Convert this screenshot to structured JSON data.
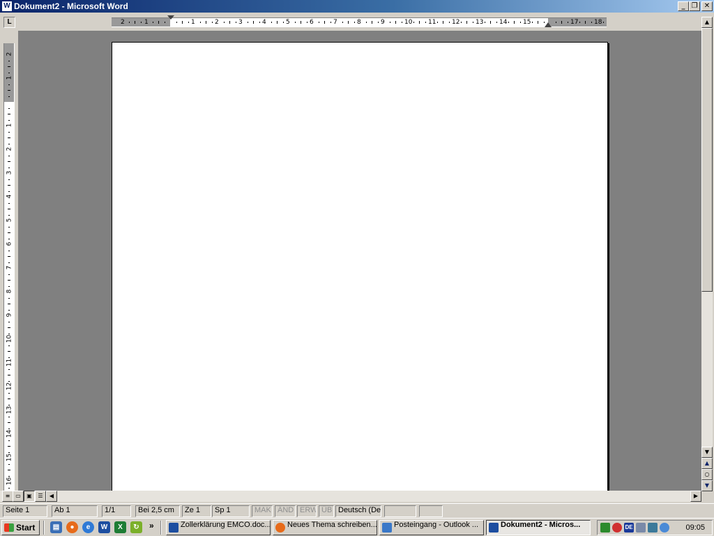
{
  "window": {
    "title": "Dokument2 - Microsoft Word",
    "app_icon": "W",
    "controls": {
      "minimize": "_",
      "restore": "❐",
      "close": "✕"
    }
  },
  "ruler": {
    "tab_selector": "L",
    "h_left_labels": [
      "2",
      "1"
    ],
    "h_labels": [
      "1",
      "2",
      "3",
      "4",
      "5",
      "6",
      "7",
      "8",
      "9",
      "10",
      "11",
      "12",
      "13",
      "14",
      "15",
      "",
      "17",
      "18"
    ],
    "v_top_labels": [
      "2",
      "1"
    ],
    "v_labels": [
      "1",
      "2",
      "3",
      "4",
      "5",
      "6",
      "7",
      "8",
      "9",
      "10",
      "11",
      "12",
      "13",
      "14",
      "15",
      "16"
    ]
  },
  "view_buttons": [
    "normal-view",
    "web-layout-view",
    "print-layout-view",
    "outline-view"
  ],
  "statusbar": {
    "seite": "Seite  1",
    "ab": "Ab  1",
    "pages": "1/1",
    "bei": "Bei  2,5 cm",
    "ze": "Ze  1",
    "sp": "Sp  1",
    "mak": "MAK",
    "and": "ÄND",
    "erw": "ERW",
    "ub": "ÜB",
    "lang": "Deutsch (De"
  },
  "taskbar": {
    "start": "Start",
    "overflow": "»",
    "quick_launch": [
      "show-desktop",
      "firefox",
      "internet-explorer",
      "word",
      "excel",
      "sync"
    ],
    "buttons": [
      {
        "label": "Zollerklärung EMCO.doc...",
        "icon": "word-icon",
        "active": false
      },
      {
        "label": "Neues Thema schreiben...",
        "icon": "firefox-icon",
        "active": false
      },
      {
        "label": "Posteingang - Outlook ...",
        "icon": "outlook-icon",
        "active": false
      },
      {
        "label": "Dokument2 - Micros...",
        "icon": "word-icon",
        "active": true
      }
    ],
    "tray": {
      "lang": "DE",
      "clock": "09:05"
    }
  },
  "colors": {
    "title_start": "#0a246a",
    "title_end": "#a6caf0",
    "workspace": "#808080",
    "chrome": "#d4d0c8"
  }
}
